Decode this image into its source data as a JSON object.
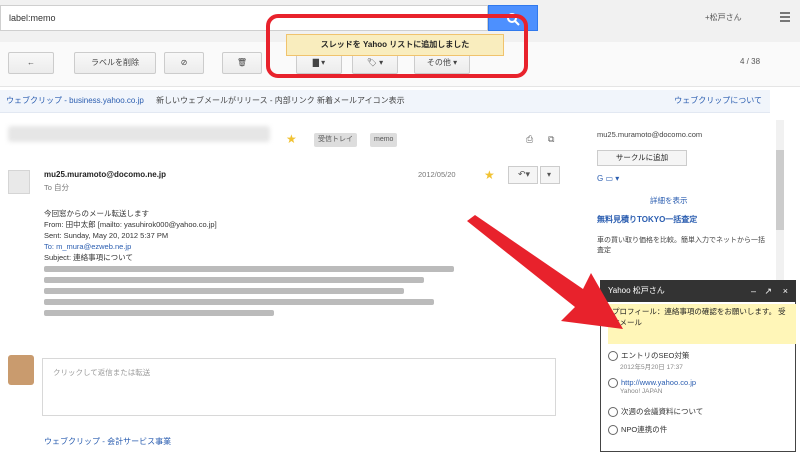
{
  "search": {
    "value": "label:memo",
    "placeholder": ""
  },
  "header": {
    "user": "+松戸さん"
  },
  "toolbar": {
    "back_label": "←",
    "labels_label": "ラベルを削除",
    "report_label": "⊘",
    "delete_label": "🗑",
    "folder_label": "▇ ▾",
    "tag_label": "🏷 ▾",
    "more_label": "その他 ▾",
    "pager": "4 / 38"
  },
  "tooltip": {
    "text": "スレッドを Yahoo リストに追加しました"
  },
  "webclip": {
    "source": "ウェブクリップ - business.yahoo.co.jp",
    "text": "新しいウェブメールがリリース - 内部リンク 新着メールアイコン表示",
    "action": "ウェブクリップについて"
  },
  "subject": {
    "tag1": "受信トレイ",
    "tag2": "memo"
  },
  "message": {
    "sender": "mu25.muramoto@docomo.ne.jp",
    "to": "To 自分",
    "date": "2012/05/20",
    "lines": [
      "今回窓からのメール転送します",
      "From: 田中太郎 [mailto: yasuhirok000@yahoo.co.jp]",
      "Sent: Sunday, May 20, 2012 5:37 PM",
      "To: m_mura@ezweb.ne.jp",
      "Subject: 連絡事項について"
    ]
  },
  "reply": {
    "placeholder": "クリックして返信または転送"
  },
  "bottom_clip": "ウェブクリップ - 会計サービス事業",
  "right": {
    "email": "mu25.muramoto@docomo.com",
    "circle_button": "サークルに追加",
    "details_link": "詳細を表示",
    "ad_title": "無料見積りTOKYO一括査定",
    "ad_text": "車の買い取り価格を比較。簡単入力でネットから一括査定"
  },
  "chat": {
    "title": "Yahoo 松戸さん",
    "highlight": "プロフィール：連絡事項の確認をお願いします。 受信メール",
    "items": [
      {
        "label": "エントリのSEO対策",
        "sub": "2012年5月20日 17:37"
      },
      {
        "label": "http://www.yahoo.co.jp",
        "sub": "Yahoo! JAPAN"
      },
      {
        "label": "次週の会議資料について",
        "sub": ""
      },
      {
        "label": "NPO連携の件",
        "sub": ""
      }
    ]
  },
  "colors": {
    "accent": "#4d90fe",
    "highlight_red": "#e8222c",
    "tooltip_bg": "#f9edbe"
  }
}
